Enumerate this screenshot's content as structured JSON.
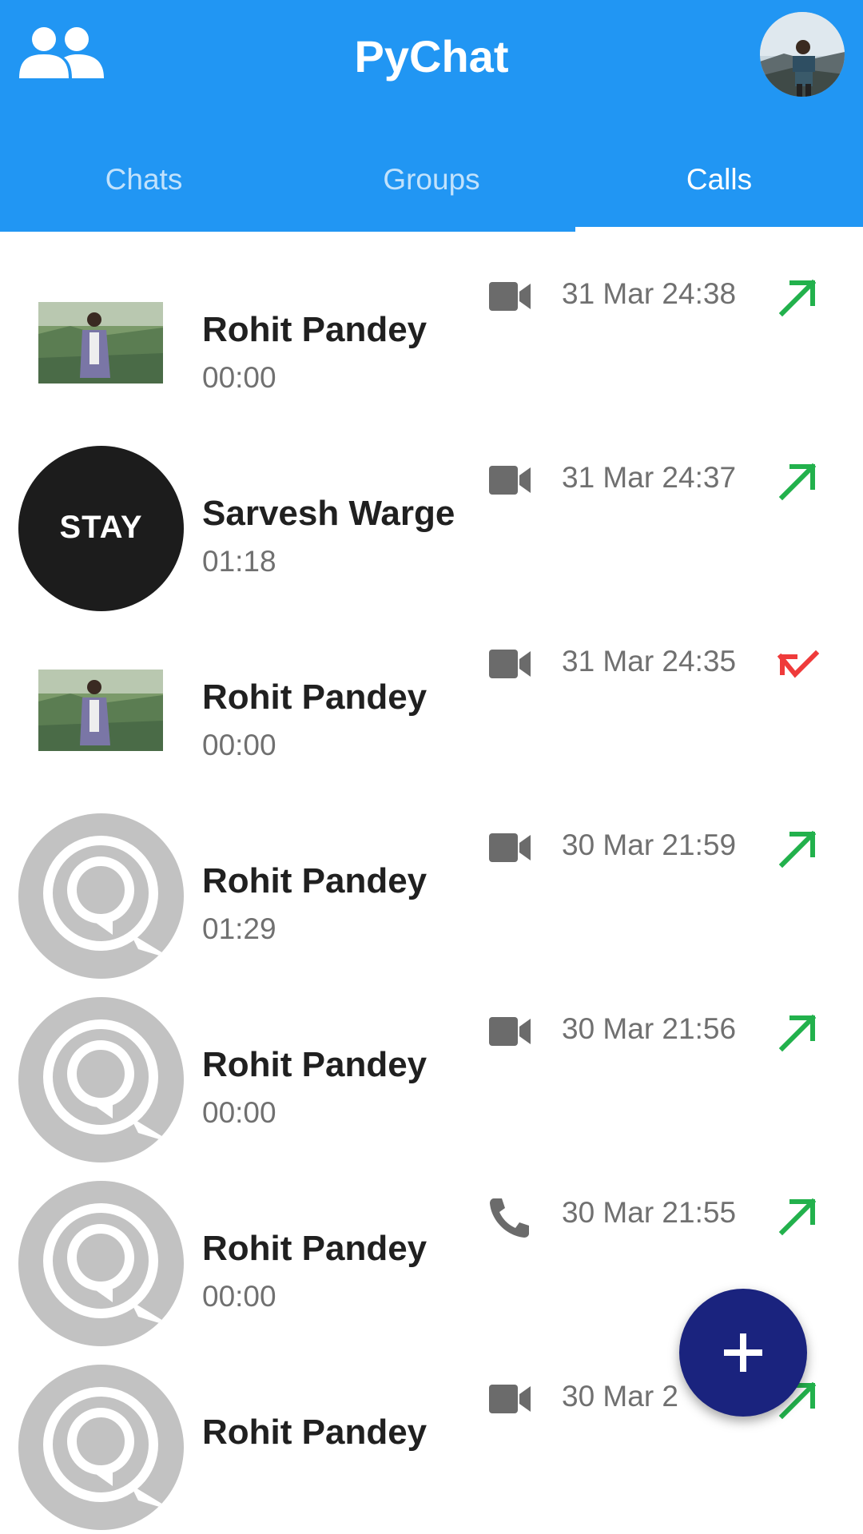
{
  "app": {
    "title": "PyChat",
    "brand_color": "#2196f3",
    "fab_color": "#1a237e",
    "fab_icon": "plus-icon",
    "header_icons": [
      "groups-icon",
      "profile-avatar"
    ]
  },
  "tabs": [
    {
      "label": "Chats",
      "active": false
    },
    {
      "label": "Groups",
      "active": false
    },
    {
      "label": "Calls",
      "active": true
    }
  ],
  "calls": [
    {
      "name": "Rohit Pandey",
      "duration": "00:00",
      "time": "31 Mar 24:38",
      "type": "video",
      "direction": "outgoing",
      "avatar": "photo"
    },
    {
      "name": "Sarvesh Warge",
      "duration": "01:18",
      "time": "31 Mar 24:37",
      "type": "video",
      "direction": "outgoing",
      "avatar": "stay-logo",
      "avatar_text": "STAY"
    },
    {
      "name": "Rohit Pandey",
      "duration": "00:00",
      "time": "31 Mar 24:35",
      "type": "video",
      "direction": "missed",
      "avatar": "photo"
    },
    {
      "name": "Rohit Pandey",
      "duration": "01:29",
      "time": "30 Mar 21:59",
      "type": "video",
      "direction": "outgoing",
      "avatar": "default"
    },
    {
      "name": "Rohit Pandey",
      "duration": "00:00",
      "time": "30 Mar 21:56",
      "type": "video",
      "direction": "outgoing",
      "avatar": "default"
    },
    {
      "name": "Rohit Pandey",
      "duration": "00:00",
      "time": "30 Mar 21:55",
      "type": "voice",
      "direction": "outgoing",
      "avatar": "default"
    },
    {
      "name": "Rohit Pandey",
      "duration": "",
      "time": "30 Mar 2",
      "type": "video",
      "direction": "outgoing",
      "avatar": "default"
    }
  ],
  "colors": {
    "outgoing_arrow": "#22b14c",
    "missed_arrow": "#ef3b3b",
    "call_icon": "#6b6b6b",
    "default_avatar": "#c2c2c2"
  }
}
